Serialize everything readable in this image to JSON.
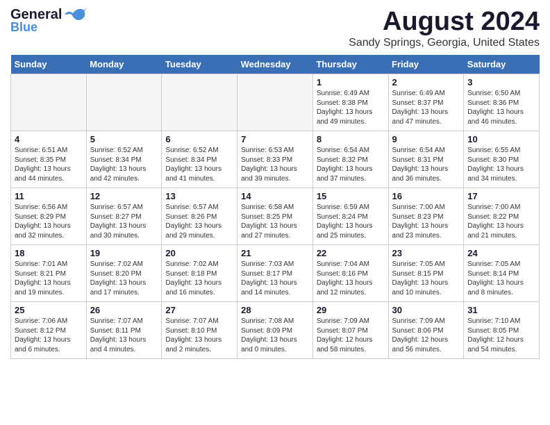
{
  "header": {
    "logo_general": "General",
    "logo_blue": "Blue",
    "month_title": "August 2024",
    "location": "Sandy Springs, Georgia, United States"
  },
  "days_of_week": [
    "Sunday",
    "Monday",
    "Tuesday",
    "Wednesday",
    "Thursday",
    "Friday",
    "Saturday"
  ],
  "weeks": [
    [
      {
        "day": "",
        "info": ""
      },
      {
        "day": "",
        "info": ""
      },
      {
        "day": "",
        "info": ""
      },
      {
        "day": "",
        "info": ""
      },
      {
        "day": "1",
        "info": "Sunrise: 6:49 AM\nSunset: 8:38 PM\nDaylight: 13 hours\nand 49 minutes."
      },
      {
        "day": "2",
        "info": "Sunrise: 6:49 AM\nSunset: 8:37 PM\nDaylight: 13 hours\nand 47 minutes."
      },
      {
        "day": "3",
        "info": "Sunrise: 6:50 AM\nSunset: 8:36 PM\nDaylight: 13 hours\nand 46 minutes."
      }
    ],
    [
      {
        "day": "4",
        "info": "Sunrise: 6:51 AM\nSunset: 8:35 PM\nDaylight: 13 hours\nand 44 minutes."
      },
      {
        "day": "5",
        "info": "Sunrise: 6:52 AM\nSunset: 8:34 PM\nDaylight: 13 hours\nand 42 minutes."
      },
      {
        "day": "6",
        "info": "Sunrise: 6:52 AM\nSunset: 8:34 PM\nDaylight: 13 hours\nand 41 minutes."
      },
      {
        "day": "7",
        "info": "Sunrise: 6:53 AM\nSunset: 8:33 PM\nDaylight: 13 hours\nand 39 minutes."
      },
      {
        "day": "8",
        "info": "Sunrise: 6:54 AM\nSunset: 8:32 PM\nDaylight: 13 hours\nand 37 minutes."
      },
      {
        "day": "9",
        "info": "Sunrise: 6:54 AM\nSunset: 8:31 PM\nDaylight: 13 hours\nand 36 minutes."
      },
      {
        "day": "10",
        "info": "Sunrise: 6:55 AM\nSunset: 8:30 PM\nDaylight: 13 hours\nand 34 minutes."
      }
    ],
    [
      {
        "day": "11",
        "info": "Sunrise: 6:56 AM\nSunset: 8:29 PM\nDaylight: 13 hours\nand 32 minutes."
      },
      {
        "day": "12",
        "info": "Sunrise: 6:57 AM\nSunset: 8:27 PM\nDaylight: 13 hours\nand 30 minutes."
      },
      {
        "day": "13",
        "info": "Sunrise: 6:57 AM\nSunset: 8:26 PM\nDaylight: 13 hours\nand 29 minutes."
      },
      {
        "day": "14",
        "info": "Sunrise: 6:58 AM\nSunset: 8:25 PM\nDaylight: 13 hours\nand 27 minutes."
      },
      {
        "day": "15",
        "info": "Sunrise: 6:59 AM\nSunset: 8:24 PM\nDaylight: 13 hours\nand 25 minutes."
      },
      {
        "day": "16",
        "info": "Sunrise: 7:00 AM\nSunset: 8:23 PM\nDaylight: 13 hours\nand 23 minutes."
      },
      {
        "day": "17",
        "info": "Sunrise: 7:00 AM\nSunset: 8:22 PM\nDaylight: 13 hours\nand 21 minutes."
      }
    ],
    [
      {
        "day": "18",
        "info": "Sunrise: 7:01 AM\nSunset: 8:21 PM\nDaylight: 13 hours\nand 19 minutes."
      },
      {
        "day": "19",
        "info": "Sunrise: 7:02 AM\nSunset: 8:20 PM\nDaylight: 13 hours\nand 17 minutes."
      },
      {
        "day": "20",
        "info": "Sunrise: 7:02 AM\nSunset: 8:18 PM\nDaylight: 13 hours\nand 16 minutes."
      },
      {
        "day": "21",
        "info": "Sunrise: 7:03 AM\nSunset: 8:17 PM\nDaylight: 13 hours\nand 14 minutes."
      },
      {
        "day": "22",
        "info": "Sunrise: 7:04 AM\nSunset: 8:16 PM\nDaylight: 13 hours\nand 12 minutes."
      },
      {
        "day": "23",
        "info": "Sunrise: 7:05 AM\nSunset: 8:15 PM\nDaylight: 13 hours\nand 10 minutes."
      },
      {
        "day": "24",
        "info": "Sunrise: 7:05 AM\nSunset: 8:14 PM\nDaylight: 13 hours\nand 8 minutes."
      }
    ],
    [
      {
        "day": "25",
        "info": "Sunrise: 7:06 AM\nSunset: 8:12 PM\nDaylight: 13 hours\nand 6 minutes."
      },
      {
        "day": "26",
        "info": "Sunrise: 7:07 AM\nSunset: 8:11 PM\nDaylight: 13 hours\nand 4 minutes."
      },
      {
        "day": "27",
        "info": "Sunrise: 7:07 AM\nSunset: 8:10 PM\nDaylight: 13 hours\nand 2 minutes."
      },
      {
        "day": "28",
        "info": "Sunrise: 7:08 AM\nSunset: 8:09 PM\nDaylight: 13 hours\nand 0 minutes."
      },
      {
        "day": "29",
        "info": "Sunrise: 7:09 AM\nSunset: 8:07 PM\nDaylight: 12 hours\nand 58 minutes."
      },
      {
        "day": "30",
        "info": "Sunrise: 7:09 AM\nSunset: 8:06 PM\nDaylight: 12 hours\nand 56 minutes."
      },
      {
        "day": "31",
        "info": "Sunrise: 7:10 AM\nSunset: 8:05 PM\nDaylight: 12 hours\nand 54 minutes."
      }
    ]
  ]
}
